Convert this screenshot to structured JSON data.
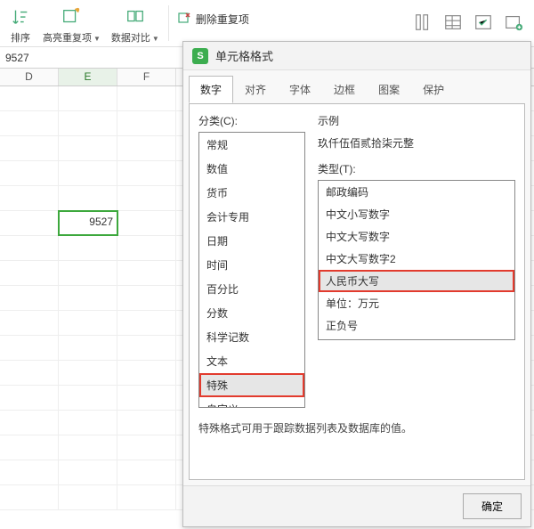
{
  "toolbar": {
    "sort_label": "排序",
    "highlight_dup_label": "高亮重复项",
    "data_compare_label": "数据对比",
    "remove_dup_label": "删除重复项"
  },
  "formula_value": "9527",
  "columns": [
    "D",
    "E",
    "F"
  ],
  "selected_cell_value": "9527",
  "dialog": {
    "title": "单元格格式",
    "tabs": [
      "数字",
      "对齐",
      "字体",
      "边框",
      "图案",
      "保护"
    ],
    "category_label": "分类(C):",
    "categories": [
      "常规",
      "数值",
      "货币",
      "会计专用",
      "日期",
      "时间",
      "百分比",
      "分数",
      "科学记数",
      "文本",
      "特殊",
      "自定义"
    ],
    "selected_category_index": 10,
    "sample_label": "示例",
    "sample_value": "玖仟伍佰贰拾柒元整",
    "type_label": "类型(T):",
    "types": [
      "邮政编码",
      "中文小写数字",
      "中文大写数字",
      "中文大写数字2",
      "人民币大写",
      "单位：万元",
      "正负号"
    ],
    "selected_type_index": 4,
    "hint": "特殊格式可用于跟踪数据列表及数据库的值。",
    "ok_label": "确定"
  }
}
